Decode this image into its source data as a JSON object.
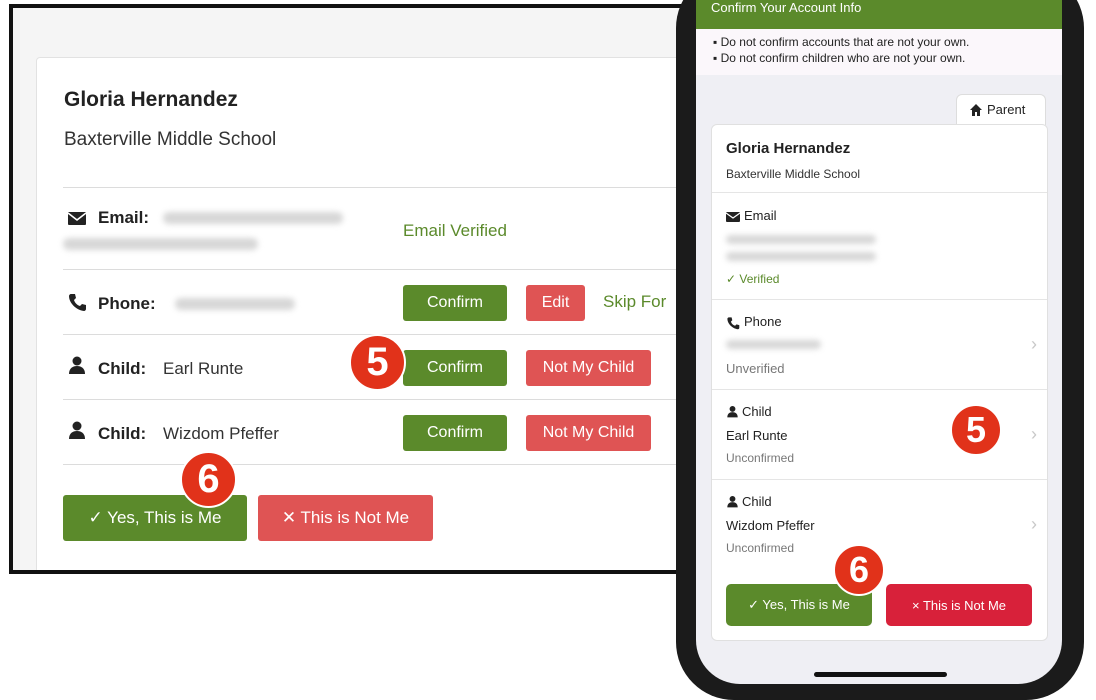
{
  "desktop": {
    "name": "Gloria Hernandez",
    "school": "Baxterville Middle School",
    "email": {
      "label": "Email:",
      "status": "Email Verified"
    },
    "phone": {
      "label": "Phone:",
      "confirm": "Confirm",
      "edit": "Edit",
      "skip": "Skip For"
    },
    "children": [
      {
        "label": "Child:",
        "name": "Earl Runte",
        "confirm": "Confirm",
        "not_my_child": "Not My Child"
      },
      {
        "label": "Child:",
        "name": "Wizdom Pfeffer",
        "confirm": "Confirm",
        "not_my_child": "Not My Child"
      }
    ],
    "yes_button": "✓ Yes, This is Me",
    "no_button": "✕ This is Not Me"
  },
  "badges": {
    "five": "5",
    "six": "6"
  },
  "mobile": {
    "header": "Confirm Your Account Info",
    "notes": [
      "Do not confirm accounts that are not your own.",
      "Do not confirm children who are not your own."
    ],
    "tab": "Parent",
    "name": "Gloria Hernandez",
    "school": "Baxterville Middle School",
    "email": {
      "label": "Email",
      "status": "Verified"
    },
    "phone": {
      "label": "Phone",
      "status": "Unverified"
    },
    "children": [
      {
        "label": "Child",
        "name": "Earl Runte",
        "status": "Unconfirmed"
      },
      {
        "label": "Child",
        "name": "Wizdom Pfeffer",
        "status": "Unconfirmed"
      }
    ],
    "yes_button": "✓ Yes, This is Me",
    "no_button": "× This is Not Me"
  },
  "colors": {
    "green": "#5b8a2b",
    "red": "#df5454",
    "badge": "#e1321a"
  }
}
